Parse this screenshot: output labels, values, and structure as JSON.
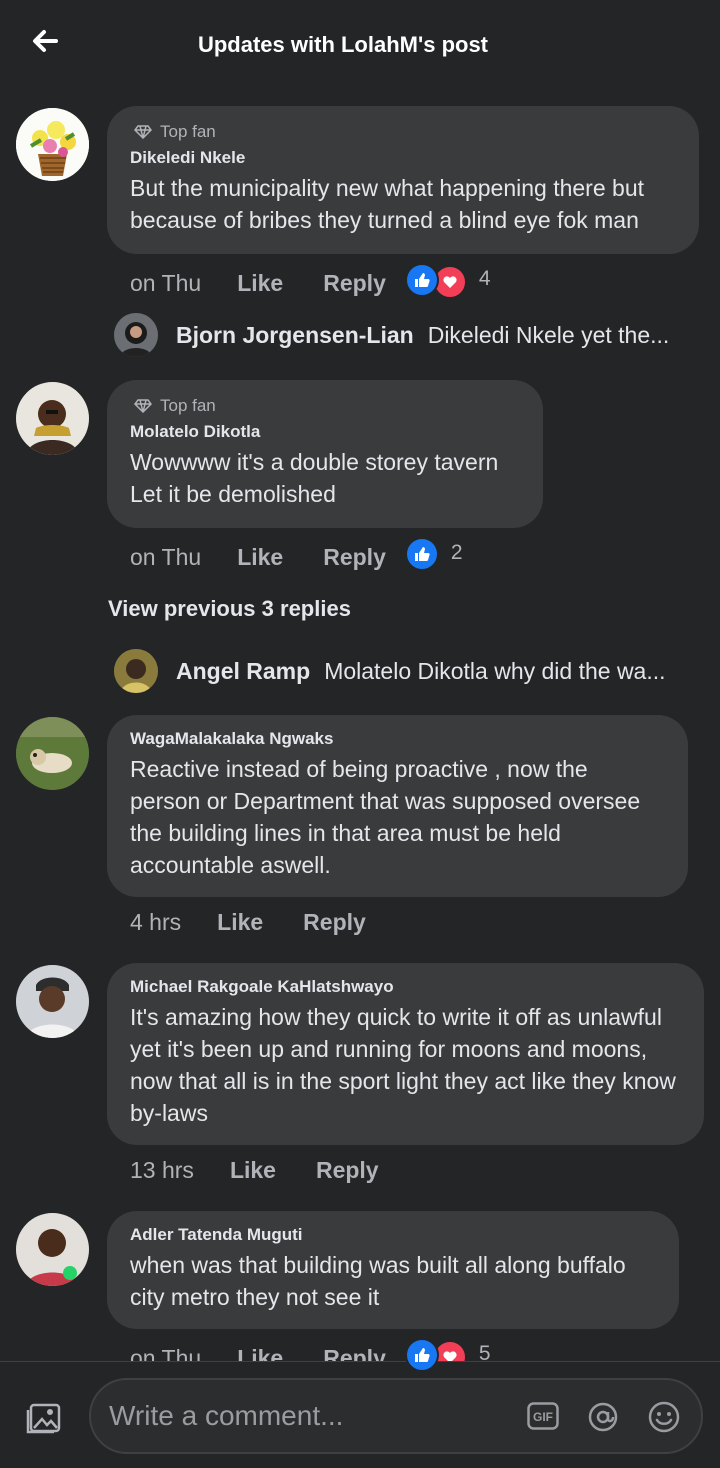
{
  "header": {
    "title": "Updates with LolahM's post"
  },
  "comments": [
    {
      "top_fan": "Top fan",
      "author": "Dikeledi Nkele",
      "text": "But  the municipality new what happening there but because of bribes they turned a blind eye fok man",
      "time": "on Thu",
      "like": "Like",
      "reply": "Reply",
      "reaction_count": "4"
    },
    {
      "top_fan": "Top fan",
      "author": "Molatelo Dikotla",
      "text": "Wowwww it's a double storey tavern\nLet it be demolished",
      "time": "on Thu",
      "like": "Like",
      "reply": "Reply",
      "reaction_count": "2"
    },
    {
      "author": "WagaMalakalaka Ngwaks",
      "text": "Reactive instead of being proactive , now the person or Department that was supposed oversee the building lines in that area must be held accountable aswell.",
      "time": "4 hrs",
      "like": "Like",
      "reply": "Reply"
    },
    {
      "author": "Michael Rakgoale KaHlatshwayo",
      "text": "It's amazing how they quick to write it off as unlawful yet it's been up and running for moons and moons, now that all is in the sport light they act like they know by-laws",
      "time": "13 hrs",
      "like": "Like",
      "reply": "Reply"
    },
    {
      "author": "Adler Tatenda Muguti",
      "text": "when was that building was built all along buffalo city metro they not see it",
      "time": "on Thu",
      "like": "Like",
      "reply": "Reply",
      "reaction_count": "5"
    }
  ],
  "replies": [
    {
      "author": "Bjorn Jorgensen-Lian",
      "text": "Dikeledi Nkele yet the..."
    },
    {
      "author": "Angel Ramp",
      "text": "Molatelo Dikotla why did the wa..."
    }
  ],
  "view_previous": "View previous 3 replies",
  "composer": {
    "placeholder": "Write a comment..."
  },
  "colors": {
    "background": "#242527",
    "bubble": "#3a3b3c",
    "like_blue": "#1877f2",
    "love_red": "#f33e58"
  }
}
